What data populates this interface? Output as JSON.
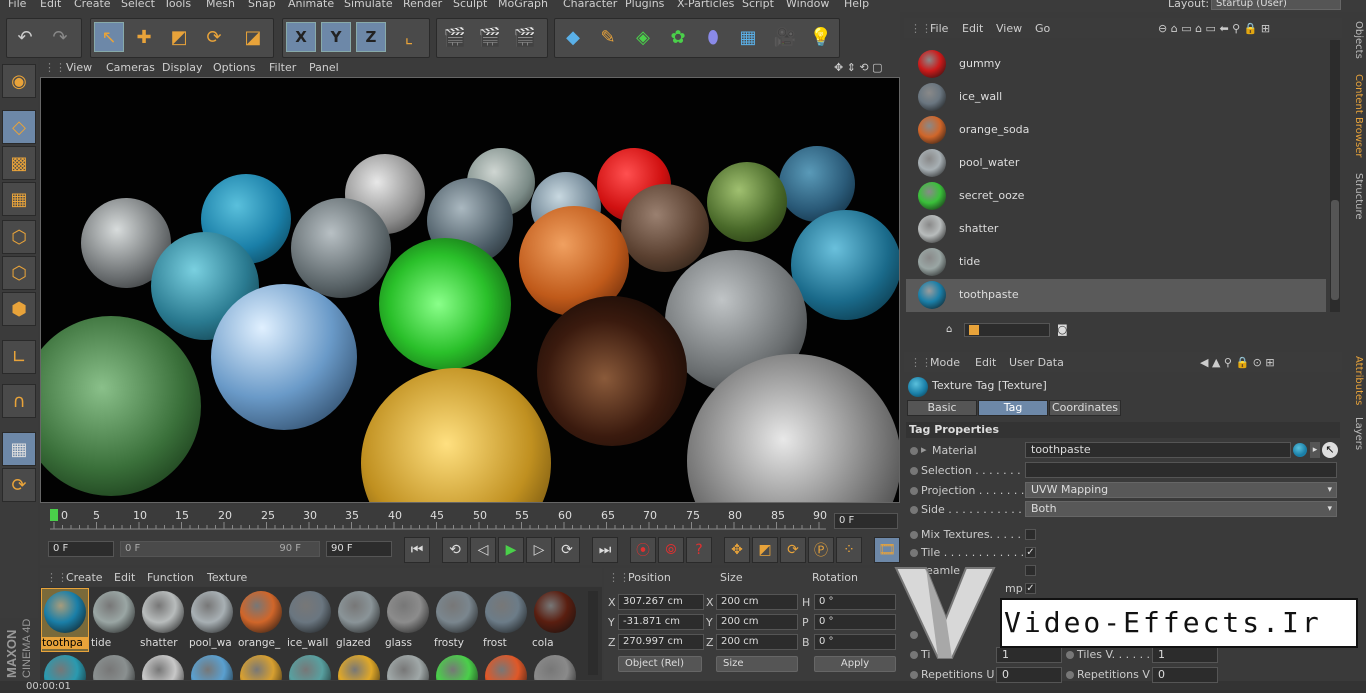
{
  "menubar": {
    "items": [
      "File",
      "Edit",
      "Create",
      "Select",
      "Tools",
      "Mesh",
      "Snap",
      "Animate",
      "Simulate",
      "Render",
      "Sculpt",
      "MoGraph",
      "Character",
      "Plugins",
      "X-Particles",
      "Script",
      "Window",
      "Help"
    ],
    "layout_label": "Layout:",
    "layout_value": "Startup (User)"
  },
  "toolbar": {
    "icons": [
      "undo-icon",
      "redo-icon",
      "live-select-icon",
      "move-icon",
      "scale-icon",
      "rotate-icon",
      "recent-tool-icon",
      "x-axis-icon",
      "y-axis-icon",
      "z-axis-icon",
      "coordinate-system-icon",
      "render-view-icon",
      "render-picture-viewer-icon",
      "edit-render-settings-icon",
      "cube-icon",
      "spline-pen-icon",
      "subdivision-surface-icon",
      "cloner-icon",
      "deformer-icon",
      "floor-icon",
      "camera-icon",
      "light-icon"
    ],
    "axis_labels": [
      "X",
      "Y",
      "Z"
    ]
  },
  "leftbar": {
    "icons": [
      "make-editable-icon",
      "model-mode-icon",
      "texture-mode-icon",
      "workplane-icon",
      "points-mode-icon",
      "edges-mode-icon",
      "polygons-mode-icon",
      "enable-axis-icon",
      "magnet-icon",
      "snap-lock-icon",
      "snap-toggle-icon"
    ]
  },
  "viewport": {
    "menu": [
      "View",
      "Cameras",
      "Display",
      "Options",
      "Filter",
      "Panel"
    ]
  },
  "timeline": {
    "ticks": [
      "0",
      "5",
      "10",
      "15",
      "20",
      "25",
      "30",
      "35",
      "40",
      "45",
      "50",
      "55",
      "60",
      "65",
      "70",
      "75",
      "80",
      "85",
      "90"
    ],
    "current_frame": "0 F"
  },
  "transport": {
    "start_field": "0 F",
    "range_start": "0 F",
    "range_end": "90 F",
    "end_field": "90 F"
  },
  "material_manager": {
    "menu": [
      "Create",
      "Edit",
      "Function",
      "Texture"
    ],
    "materials": [
      {
        "label": "toothpa",
        "color": "#1a7fa8",
        "selected": true
      },
      {
        "label": "tide",
        "color": "#9aa6a4"
      },
      {
        "label": "shatter",
        "color": "#b8bcbc"
      },
      {
        "label": "pool_wa",
        "color": "#a8b0b4"
      },
      {
        "label": "orange_",
        "color": "#d0662a"
      },
      {
        "label": "ice_wall",
        "color": "#6a7680"
      },
      {
        "label": "glazed",
        "color": "#8a9498"
      },
      {
        "label": "glass",
        "color": "#8c8c8c"
      },
      {
        "label": "frosty",
        "color": "#7a868e"
      },
      {
        "label": "frost",
        "color": "#6c7c88"
      },
      {
        "label": "cola",
        "color": "#5a1e10"
      }
    ],
    "row2_colors": [
      "#2a9ab0",
      "#8a9090",
      "#c8c8c8",
      "#5aa0d0",
      "#d8a030",
      "#58a0a0",
      "#e0a828",
      "#a0a8a8",
      "#4ad04a",
      "#e05828",
      "#8a8a8a"
    ]
  },
  "coordinates": {
    "headers": [
      "Position",
      "Size",
      "Rotation"
    ],
    "rows": [
      {
        "axis": "X",
        "pos": "307.267 cm",
        "size_axis": "X",
        "size": "200 cm",
        "rot_axis": "H",
        "rot": "0 °"
      },
      {
        "axis": "Y",
        "pos": "-31.871 cm",
        "size_axis": "Y",
        "size": "200 cm",
        "rot_axis": "P",
        "rot": "0 °"
      },
      {
        "axis": "Z",
        "pos": "270.997 cm",
        "size_axis": "Z",
        "size": "200 cm",
        "rot_axis": "B",
        "rot": "0 °"
      }
    ],
    "mode_select": "Object (Rel)",
    "size_select": "Size",
    "apply": "Apply"
  },
  "status": {
    "text": "00:00:01"
  },
  "logo": {
    "brand": "MAXON",
    "product": "CINEMA 4D"
  },
  "object_manager": {
    "menu": [
      "File",
      "Edit",
      "View",
      "Go"
    ],
    "items": [
      {
        "label": "gummy",
        "color": "#cc1a1a"
      },
      {
        "label": "ice_wall",
        "color": "#6a7680"
      },
      {
        "label": "orange_soda",
        "color": "#d0662a"
      },
      {
        "label": "pool_water",
        "color": "#a8b0b4"
      },
      {
        "label": "secret_ooze",
        "color": "#3ac03a"
      },
      {
        "label": "shatter",
        "color": "#b8bcbc"
      },
      {
        "label": "tide",
        "color": "#9aa6a4"
      },
      {
        "label": "toothpaste",
        "color": "#1a7fa8",
        "selected": true
      }
    ]
  },
  "side_tabs": {
    "top": [
      "Objects",
      "Content Browser",
      "Structure"
    ],
    "bottom": [
      "Attributes",
      "Layers"
    ]
  },
  "attributes": {
    "menu": [
      "Mode",
      "Edit",
      "User Data"
    ],
    "title": "Texture Tag [Texture]",
    "tabs": [
      "Basic",
      "Tag",
      "Coordinates"
    ],
    "active_tab": "Tag",
    "section": "Tag Properties",
    "material_label": "Material",
    "material_value": "toothpaste",
    "selection_label": "Selection . . . . . . . .",
    "projection_label": "Projection . . . . . . .",
    "projection_value": "UVW Mapping",
    "side_label": "Side . . . . . . . . . . . .",
    "side_value": "Both",
    "mix_label": "Mix Textures. . . . . .",
    "tile_label": "Tile . . . . . . . . . . . .",
    "seamless_label": "eamle",
    "uvwbump_label": "mp",
    "tiles_u_label": "Ti",
    "tiles_u_value": "1",
    "tiles_v_label": "Tiles V. . . . . . .",
    "tiles_v_value": "1",
    "rep_u_label": "Repetitions U",
    "rep_u_value": "0",
    "rep_v_label": "Repetitions V",
    "rep_v_value": "0"
  },
  "watermark": {
    "text": "Video-Effects.Ir"
  }
}
